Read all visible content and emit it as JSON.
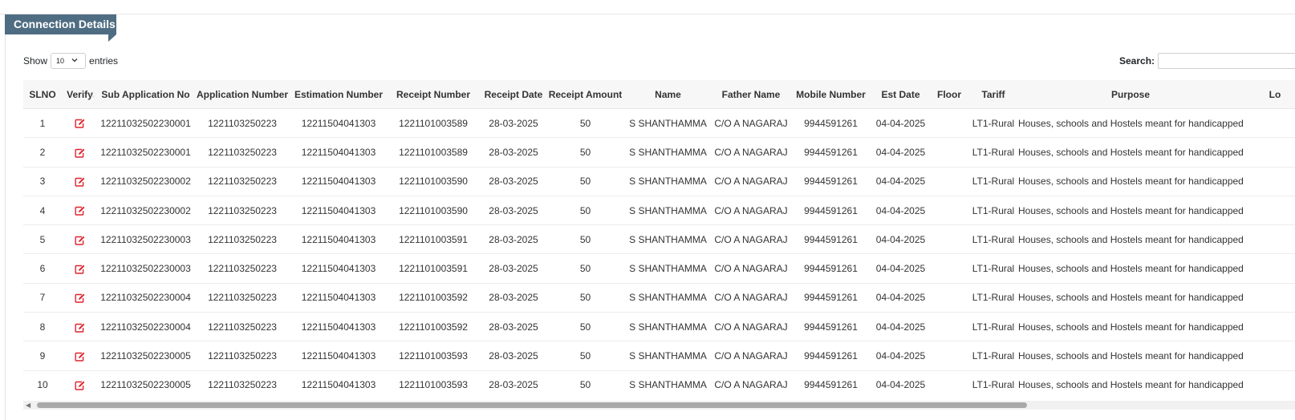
{
  "section": {
    "title": "Connection Details"
  },
  "length_control": {
    "show_label": "Show",
    "selected": "10",
    "entries_label": "entries"
  },
  "search": {
    "label": "Search:",
    "value": ""
  },
  "table": {
    "columns": [
      "SLNO",
      "Verify",
      "Sub Application No",
      "Application Number",
      "Estimation Number",
      "Receipt Number",
      "Receipt Date",
      "Receipt Amount",
      "Name",
      "Father Name",
      "Mobile Number",
      "Est Date",
      "Floor",
      "Tariff",
      "Purpose",
      "Lo"
    ],
    "rows": [
      [
        "1",
        "",
        "12211032502230001",
        "1221103250223",
        "12211504041303",
        "1221101003589",
        "28-03-2025",
        "50",
        "S SHANTHAMMA",
        "C/O A NAGARAJ",
        "9944591261",
        "04-04-2025",
        "",
        "LT1-Rural",
        "Houses, schools and Hostels meant for handicapped",
        ""
      ],
      [
        "2",
        "",
        "12211032502230001",
        "1221103250223",
        "12211504041303",
        "1221101003589",
        "28-03-2025",
        "50",
        "S SHANTHAMMA",
        "C/O A NAGARAJ",
        "9944591261",
        "04-04-2025",
        "",
        "LT1-Rural",
        "Houses, schools and Hostels meant for handicapped",
        ""
      ],
      [
        "3",
        "",
        "12211032502230002",
        "1221103250223",
        "12211504041303",
        "1221101003590",
        "28-03-2025",
        "50",
        "S SHANTHAMMA",
        "C/O A NAGARAJ",
        "9944591261",
        "04-04-2025",
        "",
        "LT1-Rural",
        "Houses, schools and Hostels meant for handicapped",
        ""
      ],
      [
        "4",
        "",
        "12211032502230002",
        "1221103250223",
        "12211504041303",
        "1221101003590",
        "28-03-2025",
        "50",
        "S SHANTHAMMA",
        "C/O A NAGARAJ",
        "9944591261",
        "04-04-2025",
        "",
        "LT1-Rural",
        "Houses, schools and Hostels meant for handicapped",
        ""
      ],
      [
        "5",
        "",
        "12211032502230003",
        "1221103250223",
        "12211504041303",
        "1221101003591",
        "28-03-2025",
        "50",
        "S SHANTHAMMA",
        "C/O A NAGARAJ",
        "9944591261",
        "04-04-2025",
        "",
        "LT1-Rural",
        "Houses, schools and Hostels meant for handicapped",
        ""
      ],
      [
        "6",
        "",
        "12211032502230003",
        "1221103250223",
        "12211504041303",
        "1221101003591",
        "28-03-2025",
        "50",
        "S SHANTHAMMA",
        "C/O A NAGARAJ",
        "9944591261",
        "04-04-2025",
        "",
        "LT1-Rural",
        "Houses, schools and Hostels meant for handicapped",
        ""
      ],
      [
        "7",
        "",
        "12211032502230004",
        "1221103250223",
        "12211504041303",
        "1221101003592",
        "28-03-2025",
        "50",
        "S SHANTHAMMA",
        "C/O A NAGARAJ",
        "9944591261",
        "04-04-2025",
        "",
        "LT1-Rural",
        "Houses, schools and Hostels meant for handicapped",
        ""
      ],
      [
        "8",
        "",
        "12211032502230004",
        "1221103250223",
        "12211504041303",
        "1221101003592",
        "28-03-2025",
        "50",
        "S SHANTHAMMA",
        "C/O A NAGARAJ",
        "9944591261",
        "04-04-2025",
        "",
        "LT1-Rural",
        "Houses, schools and Hostels meant for handicapped",
        ""
      ],
      [
        "9",
        "",
        "12211032502230005",
        "1221103250223",
        "12211504041303",
        "1221101003593",
        "28-03-2025",
        "50",
        "S SHANTHAMMA",
        "C/O A NAGARAJ",
        "9944591261",
        "04-04-2025",
        "",
        "LT1-Rural",
        "Houses, schools and Hostels meant for handicapped",
        ""
      ],
      [
        "10",
        "",
        "12211032502230005",
        "1221103250223",
        "12211504041303",
        "1221101003593",
        "28-03-2025",
        "50",
        "S SHANTHAMMA",
        "C/O A NAGARAJ",
        "9944591261",
        "04-04-2025",
        "",
        "LT1-Rural",
        "Houses, schools and Hostels meant for handicapped",
        ""
      ]
    ]
  },
  "icons": {
    "verify": "edit-icon",
    "sort": "sort-icon",
    "length_dropdown": "chevron-down-icon",
    "scroll_left": "arrow-left-icon"
  },
  "colors": {
    "section_tab": "#4f6d82",
    "verify_icon": "#e0242f",
    "header_bg": "#f7f7f7",
    "scroll_thumb": "#a9a9a9"
  }
}
